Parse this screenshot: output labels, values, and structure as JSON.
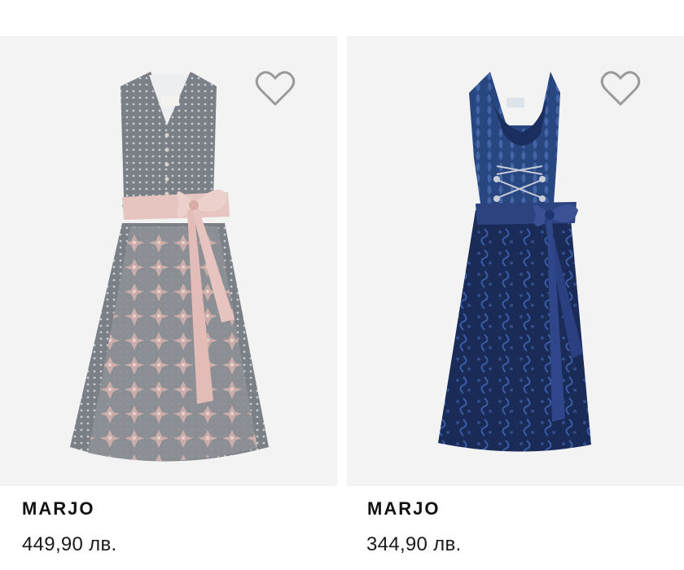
{
  "products": [
    {
      "brand": "MARJO",
      "price": "449,90 лв.",
      "image": "grey-pink-lace-dirndl",
      "wishlist_icon": "heart-outline-icon",
      "colors": {
        "bodice": "#7d8187",
        "skirt": "#9a9ea3",
        "bow": "#e8c8c4",
        "lace": "#e3b9b5"
      }
    },
    {
      "brand": "MARJO",
      "price": "344,90 лв.",
      "image": "navy-lace-dirndl",
      "wishlist_icon": "heart-outline-icon",
      "colors": {
        "bodice": "#2e4b86",
        "skirt": "#182a55",
        "bow": "#2a3f7a",
        "lace": "#3a5aa0"
      }
    }
  ]
}
